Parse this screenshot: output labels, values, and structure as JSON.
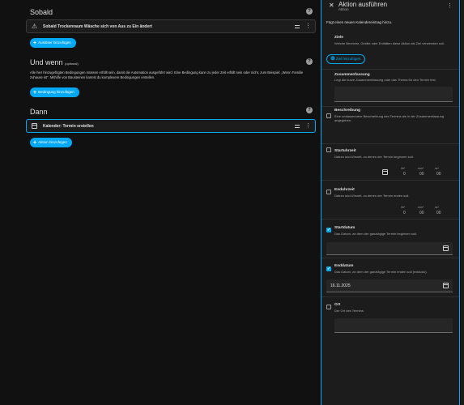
{
  "main": {
    "trigger": {
      "title": "Sobald",
      "card_label": "Sobald Trockenraum Wäsche sich von Aus zu Ein ändert",
      "add_button": "Auslöser hinzufügen"
    },
    "condition": {
      "title": "Und wenn",
      "optional": "(optional)",
      "description": "Alle hier hinzugefügten Bedingungen müssen erfüllt sein, damit die Automation ausgeführt wird. Eine Bedingung kann zu jeder Zeit erfüllt sein oder nicht, zum Beispiel: „Wenn Familie zuhause ist“. Mithilfe von Bausteinen kannst du komplexere Bedingungen erstellen.",
      "add_button": "Bedingung hinzufügen"
    },
    "action": {
      "title": "Dann",
      "card_label": "Kalender: Termin erstellen",
      "add_button": "Aktion hinzufügen"
    }
  },
  "panel": {
    "title": "Aktion ausführen",
    "subtitle": "Aktion",
    "description": "Fügt einen neuen Kalendereintrag hinzu.",
    "target": {
      "label": "Ziele",
      "description": "Welche Bereiche, Geräte oder Entitäten diese Aktion als Ziel verwenden soll.",
      "button": "Ziel hinzufügen"
    },
    "fields": {
      "summary": {
        "label": "Zusammenfassung",
        "description": "Legt die kurze Zusammenfassung oder das Thema für den Termin fest."
      },
      "description": {
        "label": "Beschreibung",
        "description": "Eine umfassendere Beschreibung des Termins als in der Zusammenfassung angegeben."
      },
      "start_time": {
        "label": "Startuhrzeit",
        "description": "Datum und Uhrzeit, zu denen der Termin beginnen soll.",
        "units": [
          "hh*",
          "mm*",
          "ss*"
        ],
        "values": [
          "0",
          "00",
          "00"
        ]
      },
      "end_time": {
        "label": "Enduhrzeit",
        "description": "Datum und Uhrzeit, zu denen der Termin enden soll.",
        "units": [
          "hh*",
          "mm*",
          "ss*"
        ],
        "values": [
          "0",
          "00",
          "00"
        ]
      },
      "start_date": {
        "label": "Startdatum",
        "description": "Das Datum, an dem der ganztägige Termin beginnen soll.",
        "value": "",
        "checked": true
      },
      "end_date": {
        "label": "Enddatum",
        "description": "Das Datum, an dem der ganztägige Termin enden soll (exklusiv).",
        "value": "16.11.2025",
        "checked": true
      },
      "location": {
        "label": "Ort",
        "description": "Der Ort des Termins."
      }
    }
  },
  "colors": {
    "accent": "#03a9f4",
    "background": "#111111",
    "card": "#1c1c1c"
  },
  "icons": [
    "alert-triangle-icon",
    "calendar-icon",
    "plus-icon",
    "drag-handle-icon",
    "kebab-menu-icon",
    "help-icon",
    "close-icon",
    "target-plus-icon",
    "checkbox-icon"
  ]
}
